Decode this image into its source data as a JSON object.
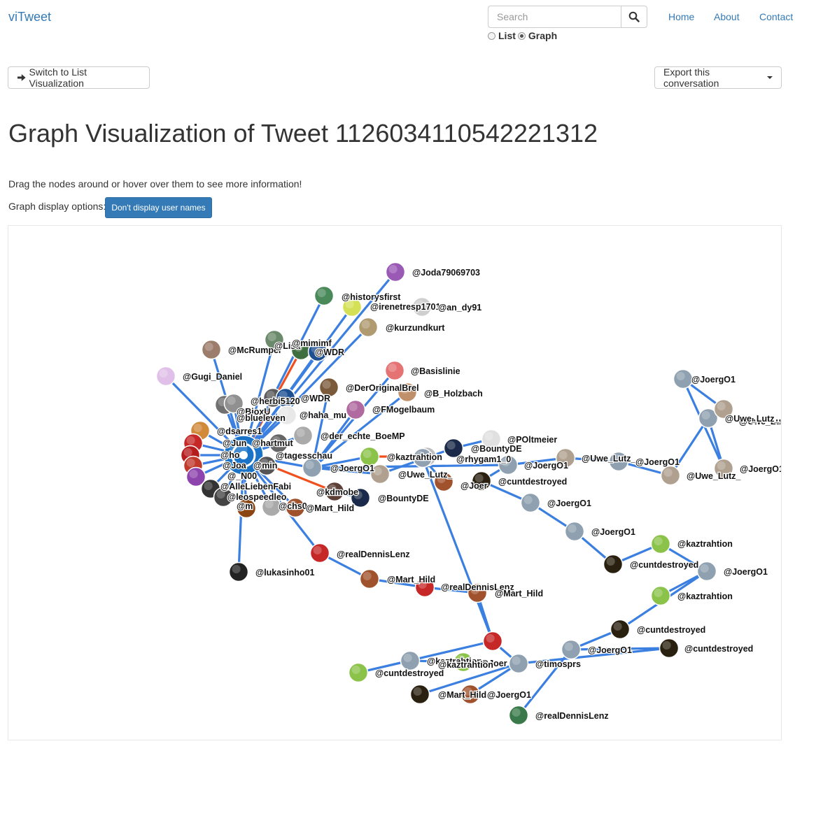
{
  "app": {
    "brand": "viTweet"
  },
  "search": {
    "placeholder": "Search",
    "icon": "search-icon"
  },
  "mode": {
    "list_label": "List",
    "graph_label": "Graph",
    "selected": "Graph"
  },
  "nav": {
    "home": "Home",
    "about": "About",
    "contact": "Contact"
  },
  "toolbar": {
    "switch_label": "Switch to List Visualization",
    "switch_icon": "arrow-right-icon",
    "export_label": "Export this conversation"
  },
  "page": {
    "title": "Graph Visualization of Tweet 1126034110542221312",
    "instructions": "Drag the nodes around or hover over them to see more information!",
    "options_label": "Graph display options:",
    "options_button": "Don't display user names"
  },
  "graph": {
    "colors": {
      "link": "#3b7fe0",
      "link_highlight": "#f0501e",
      "root": "#1a73c7"
    },
    "nodes": [
      {
        "label": "@tagesschau",
        "color": "#1a73c7",
        "root": true
      },
      {
        "label": "@Joda79069703",
        "color": "#9b59b6"
      },
      {
        "label": "@historysfirst",
        "color": "#4a8a5a"
      },
      {
        "label": "@irenetresp1701",
        "color": "#d4e157"
      },
      {
        "label": "@an_dy91",
        "color": "#cfcfcf"
      },
      {
        "label": "@kurzundkurt",
        "color": "#b09a70"
      },
      {
        "label": "@McRumpel",
        "color": "#9c7c6a"
      },
      {
        "label": "@Lisa",
        "color": "#6b8a6b"
      },
      {
        "label": "@mimimf",
        "color": "#3f6f3f"
      },
      {
        "label": "@WDR",
        "color": "#1d4f91"
      },
      {
        "label": "@Gugi_Daniel",
        "color": "#e0c0e8"
      },
      {
        "label": "@Basislinie",
        "color": "#e57373"
      },
      {
        "label": "@DerOriginalBrel",
        "color": "#7a5a3a"
      },
      {
        "label": "@B_Holzbach",
        "color": "#c0906a"
      },
      {
        "label": "@herbi5120",
        "color": "#5a5a5a"
      },
      {
        "label": "@WDR",
        "color": "#1d4f91"
      },
      {
        "label": "@FMogelbaum",
        "color": "#b06aa0"
      },
      {
        "label": "@BioxU",
        "color": "#707070"
      },
      {
        "label": "@blueleven",
        "color": "#909090"
      },
      {
        "label": "@haha_mu",
        "color": "#e8e8e8"
      },
      {
        "label": "@dsarres1",
        "color": "#d08a3a"
      },
      {
        "label": "@der_echte_BoeMP",
        "color": "#aaaaaa"
      },
      {
        "label": "@Jun",
        "color": "#c62828"
      },
      {
        "label": "@hartmut",
        "color": "#666666"
      },
      {
        "label": "@ho",
        "color": "#b71c1c"
      },
      {
        "label": "@Joa",
        "color": "#c0392b"
      },
      {
        "label": "@min",
        "color": "#555555"
      },
      {
        "label": "@_N00",
        "color": "#8e44ad"
      },
      {
        "label": "@AlleLiebenFabi",
        "color": "#333333"
      },
      {
        "label": "@leospeedleo",
        "color": "#444444"
      },
      {
        "label": "@m",
        "color": "#8b4513"
      },
      {
        "label": "@chs0",
        "color": "#aaaaaa"
      },
      {
        "label": "@kdmobe",
        "color": "#5d4037"
      },
      {
        "label": "@BountyDE",
        "color": "#1b2a4a"
      },
      {
        "label": "@Mart_Hild",
        "color": "#a0522d"
      },
      {
        "label": "@lukasinho01",
        "color": "#222222"
      },
      {
        "label": "@realDennisLenz",
        "color": "#c62828"
      },
      {
        "label": "@Mart_Hild",
        "color": "#a0522d"
      },
      {
        "label": "@realDennisLenz",
        "color": "#c62828"
      },
      {
        "label": "@Mart_Hild",
        "color": "#a0522d"
      },
      {
        "label": "@realDennisLenz",
        "color": "#c62828"
      },
      {
        "label": "@JoergO1",
        "color": "#8fa0b0"
      },
      {
        "label": "@kaztrahtion",
        "color": "#8bc34a"
      },
      {
        "label": "@Uwe_Lutz_",
        "color": "#b0a090"
      },
      {
        "label": "@rhygam1_0",
        "color": "#c0c0c0"
      },
      {
        "label": "@BountyDE",
        "color": "#1b2a4a"
      },
      {
        "label": "@POltmeier",
        "color": "#e0e0e0"
      },
      {
        "label": "@JoergO1",
        "color": "#8fa0b0"
      },
      {
        "label": "@Uwe_Lutz_",
        "color": "#b0a090"
      },
      {
        "label": "@JoergO1",
        "color": "#8fa0b0"
      },
      {
        "label": "@Uwe_Lutz_",
        "color": "#b0a090"
      },
      {
        "label": "@JoergO1",
        "color": "#8fa0b0"
      },
      {
        "label": "@Uwe_Lutz_",
        "color": "#b0a090"
      },
      {
        "label": "@JoergO1",
        "color": "#8fa0b0"
      },
      {
        "label": "@Uwe_Lutz_",
        "color": "#b0a090"
      },
      {
        "label": "@cuntdestroyed",
        "color": "#2a2010"
      },
      {
        "label": "@JoergO1",
        "color": "#8fa0b0"
      },
      {
        "label": "@JoergO1",
        "color": "#8fa0b0"
      },
      {
        "label": "@cuntdestroyed",
        "color": "#2a2010"
      },
      {
        "label": "@kaztrahtion",
        "color": "#8bc34a"
      },
      {
        "label": "@JoergO1",
        "color": "#8fa0b0"
      },
      {
        "label": "@kaztrahtion",
        "color": "#8bc34a"
      },
      {
        "label": "@cuntdestroyed",
        "color": "#2a2010"
      },
      {
        "label": "@JoergO1",
        "color": "#8fa0b0"
      },
      {
        "label": "@cuntdestroyed",
        "color": "#2a2010"
      },
      {
        "label": "@timosprs",
        "color": "#3a7a4a"
      },
      {
        "label": "@JoergO1",
        "color": "#8fa0b0"
      },
      {
        "label": "@Mart_Hild",
        "color": "#a0522d"
      },
      {
        "label": "@cuntdestroyed",
        "color": "#2a2010"
      },
      {
        "label": "@kaztrahtion",
        "color": "#8bc34a"
      },
      {
        "label": "@Joer",
        "color": "#8fa0b0"
      },
      {
        "label": "@kaztrahtion",
        "color": "#8bc34a"
      },
      {
        "label": "@Joer",
        "color": "#8fa0b0"
      },
      {
        "label": "@1",
        "color": "#a0522d"
      }
    ],
    "links": [
      {
        "s": 0,
        "t": 1
      },
      {
        "s": 0,
        "t": 2
      },
      {
        "s": 0,
        "t": 3
      },
      {
        "s": 0,
        "t": 5
      },
      {
        "s": 0,
        "t": 6
      },
      {
        "s": 0,
        "t": 7
      },
      {
        "s": 0,
        "t": 8,
        "highlight": true
      },
      {
        "s": 0,
        "t": 9
      },
      {
        "s": 0,
        "t": 10
      },
      {
        "s": 0,
        "t": 14
      },
      {
        "s": 0,
        "t": 15
      },
      {
        "s": 0,
        "t": 17
      },
      {
        "s": 0,
        "t": 18
      },
      {
        "s": 0,
        "t": 19
      },
      {
        "s": 0,
        "t": 20
      },
      {
        "s": 0,
        "t": 21
      },
      {
        "s": 0,
        "t": 22
      },
      {
        "s": 0,
        "t": 23
      },
      {
        "s": 0,
        "t": 24
      },
      {
        "s": 0,
        "t": 25
      },
      {
        "s": 0,
        "t": 26
      },
      {
        "s": 0,
        "t": 27
      },
      {
        "s": 0,
        "t": 28
      },
      {
        "s": 0,
        "t": 29
      },
      {
        "s": 0,
        "t": 30
      },
      {
        "s": 0,
        "t": 31
      },
      {
        "s": 0,
        "t": 35
      },
      {
        "s": 0,
        "t": 36
      },
      {
        "s": 0,
        "t": 32,
        "highlight": true
      },
      {
        "s": 32,
        "t": 33
      },
      {
        "s": 0,
        "t": 34
      },
      {
        "s": 0,
        "t": 41
      },
      {
        "s": 41,
        "t": 16
      },
      {
        "s": 41,
        "t": 12
      },
      {
        "s": 41,
        "t": 11
      },
      {
        "s": 41,
        "t": 13
      },
      {
        "s": 41,
        "t": 42
      },
      {
        "s": 42,
        "t": 44,
        "highlight": true
      },
      {
        "s": 41,
        "t": 43
      },
      {
        "s": 43,
        "t": 45
      },
      {
        "s": 45,
        "t": 46
      },
      {
        "s": 41,
        "t": 47
      },
      {
        "s": 47,
        "t": 48
      },
      {
        "s": 48,
        "t": 49
      },
      {
        "s": 49,
        "t": 50
      },
      {
        "s": 50,
        "t": 51
      },
      {
        "s": 51,
        "t": 52
      },
      {
        "s": 52,
        "t": 53
      },
      {
        "s": 53,
        "t": 54
      },
      {
        "s": 47,
        "t": 55
      },
      {
        "s": 55,
        "t": 56
      },
      {
        "s": 56,
        "t": 57
      },
      {
        "s": 57,
        "t": 58
      },
      {
        "s": 58,
        "t": 59
      },
      {
        "s": 59,
        "t": 60
      },
      {
        "s": 60,
        "t": 61
      },
      {
        "s": 60,
        "t": 62
      },
      {
        "s": 62,
        "t": 63
      },
      {
        "s": 63,
        "t": 64
      },
      {
        "s": 63,
        "t": 65
      },
      {
        "s": 36,
        "t": 37
      },
      {
        "s": 37,
        "t": 38
      },
      {
        "s": 38,
        "t": 39
      },
      {
        "s": 39,
        "t": 40
      },
      {
        "s": 40,
        "t": 66
      },
      {
        "s": 66,
        "t": 67
      },
      {
        "s": 66,
        "t": 68
      },
      {
        "s": 40,
        "t": 69
      },
      {
        "s": 69,
        "t": 70
      },
      {
        "s": 70,
        "t": 71
      },
      {
        "s": 40,
        "t": 72
      },
      {
        "s": 72,
        "t": 73
      },
      {
        "s": 66,
        "t": 64
      }
    ]
  }
}
